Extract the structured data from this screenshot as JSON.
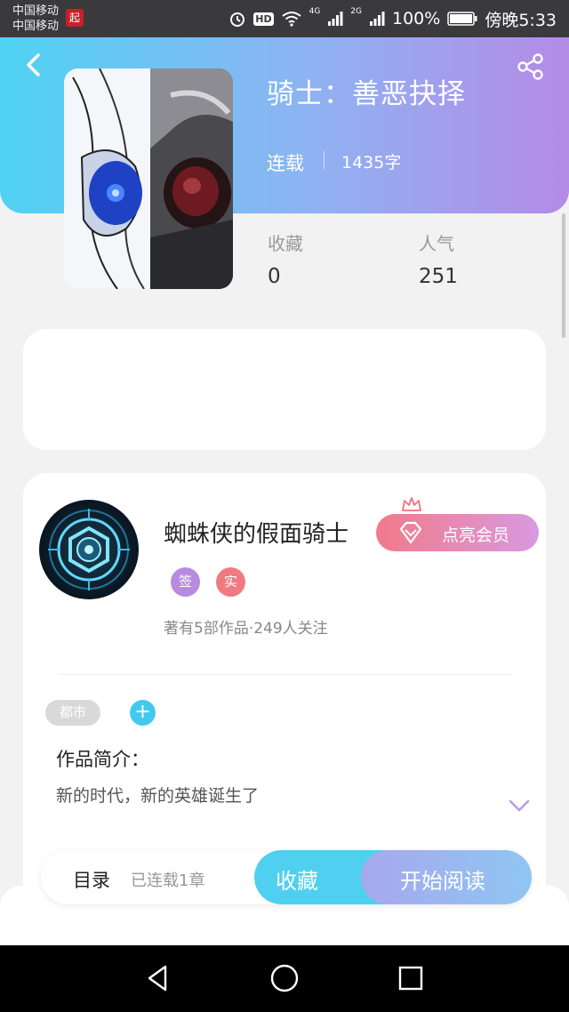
{
  "status_bar": {
    "carrier1": "中国移动",
    "carrier2": "中国移动",
    "app_badge": "起",
    "hd": "HD",
    "net1": "4G",
    "net2": "2G",
    "battery": "100%",
    "time": "傍晚5:33"
  },
  "book": {
    "title": "骑士：善恶抉择",
    "status": "连载",
    "word_count": "1435字",
    "stats": [
      {
        "label": "收藏",
        "value": "0"
      },
      {
        "label": "人气",
        "value": "251"
      }
    ]
  },
  "author": {
    "name": "蜘蛛侠的假面骑士",
    "vip_button": "点亮会员",
    "badges": [
      "签",
      "实"
    ],
    "summary": "著有5部作品·249人关注"
  },
  "tags": [
    "都市"
  ],
  "tag_add": "+",
  "intro": {
    "heading": "作品简介：",
    "text": "新的时代，新的英雄诞生了"
  },
  "action_bar": {
    "toc_label": "目录",
    "toc_count": "已连载1章",
    "collect_label": "收藏",
    "read_label": "开始阅读"
  },
  "colors": {
    "header_gradient_start": "#4fd3f2",
    "header_gradient_end": "#b48be6",
    "collect_button": "#4fd0f0",
    "vip_gradient_start": "#f27a8a",
    "vip_gradient_end": "#d89ae0"
  },
  "icons": [
    "back-arrow-icon",
    "share-icon",
    "alarm-icon",
    "wifi-icon",
    "signal-icon",
    "battery-icon",
    "diamond-icon",
    "crown-icon",
    "chevron-down-icon",
    "nav-back-icon",
    "nav-home-icon",
    "nav-recents-icon"
  ]
}
